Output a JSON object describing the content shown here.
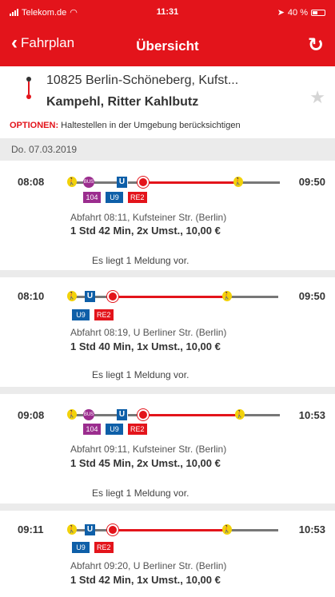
{
  "status": {
    "carrier": "Telekom.de",
    "time": "11:31",
    "battery": "40 %"
  },
  "nav": {
    "back_label": "Fahrplan",
    "title": "Übersicht"
  },
  "route": {
    "from": "10825 Berlin-Schöneberg, Kufst...",
    "to": "Kampehl, Ritter Kahlbutz",
    "options_key": "OPTIONEN:",
    "options_text": " Haltestellen in der Umgebung berücksichtigen"
  },
  "date": "Do. 07.03.2019",
  "connections": [
    {
      "dep": "08:08",
      "arr": "09:50",
      "badges": [
        "104",
        "U9",
        "RE2"
      ],
      "info": "Abfahrt 08:11, Kufsteiner Str. (Berlin)",
      "summary": "1 Std 42 Min,  2x Umst.,  10,00 €",
      "notice": "Es liegt 1 Meldung vor."
    },
    {
      "dep": "08:10",
      "arr": "09:50",
      "badges": [
        "U9",
        "RE2"
      ],
      "info": "Abfahrt 08:19, U Berliner Str. (Berlin)",
      "summary": "1 Std 40 Min,  1x Umst.,  10,00 €",
      "notice": "Es liegt 1 Meldung vor."
    },
    {
      "dep": "09:08",
      "arr": "10:53",
      "badges": [
        "104",
        "U9",
        "RE2"
      ],
      "info": "Abfahrt 09:11, Kufsteiner Str. (Berlin)",
      "summary": "1 Std 45 Min,  2x Umst.,  10,00 €",
      "notice": "Es liegt 1 Meldung vor."
    },
    {
      "dep": "09:11",
      "arr": "10:53",
      "badges": [
        "U9",
        "RE2"
      ],
      "info": "Abfahrt 09:20, U Berliner Str. (Berlin)",
      "summary": "1 Std 42 Min,  1x Umst.,  10,00 €"
    }
  ],
  "icons": {
    "walk": "walk-icon",
    "bus": "bus-icon",
    "subway": "u-bahn-icon",
    "train": "db-train-icon",
    "warning": "warning-icon",
    "star": "star-icon",
    "refresh": "refresh-icon"
  },
  "timeline_glyphs": {
    "walk": "🚶",
    "bus": "BUS",
    "subway": "U"
  },
  "colors": {
    "brand_red": "#e3141b",
    "bus": "#9b2d8e",
    "subway": "#0e5fa8",
    "walk": "#f2d20a",
    "warning": "#f2a500"
  }
}
